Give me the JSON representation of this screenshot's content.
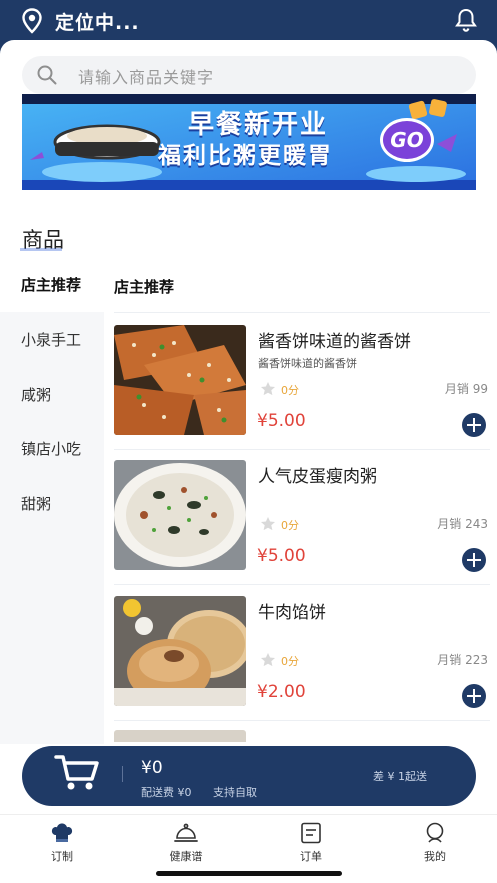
{
  "header": {
    "location_text": "定位中...",
    "location_icon": "location-pin-icon",
    "bell_icon": "bell-icon"
  },
  "search": {
    "placeholder": "请输入商品关键字"
  },
  "banner": {
    "line1": "早餐新开业",
    "line2": "福利比粥更暖胃",
    "badge": "GO"
  },
  "section": {
    "title": "商品"
  },
  "sidebar": {
    "items": [
      {
        "label": "店主推荐",
        "active": true
      },
      {
        "label": "小泉手工"
      },
      {
        "label": "咸粥"
      },
      {
        "label": "镇店小吃"
      },
      {
        "label": "甜粥"
      }
    ]
  },
  "main": {
    "category_title": "店主推荐",
    "products": [
      {
        "name": "酱香饼味道的酱香饼",
        "desc": "酱香饼味道的酱香饼",
        "score": "0分",
        "sales": "月销 99",
        "price": "¥5.00"
      },
      {
        "name": "人气皮蛋瘦肉粥",
        "desc": "",
        "score": "0分",
        "sales": "月销 243",
        "price": "¥5.00"
      },
      {
        "name": "牛肉馅饼",
        "desc": "",
        "score": "0分",
        "sales": "月销 223",
        "price": "¥2.00"
      }
    ]
  },
  "cart": {
    "total": "¥0",
    "delivery_fee": "配送费 ¥0",
    "pickup": "支持自取",
    "min_order": "差 ¥ 1起送"
  },
  "tabs": [
    {
      "label": "订制",
      "icon": "chef-hat-icon"
    },
    {
      "label": "健康谱",
      "icon": "dish-cover-icon"
    },
    {
      "label": "订单",
      "icon": "order-list-icon"
    },
    {
      "label": "我的",
      "icon": "user-icon"
    }
  ],
  "colors": {
    "primary": "#1f3a66",
    "price": "#e0433a",
    "score": "#e8a63a"
  }
}
